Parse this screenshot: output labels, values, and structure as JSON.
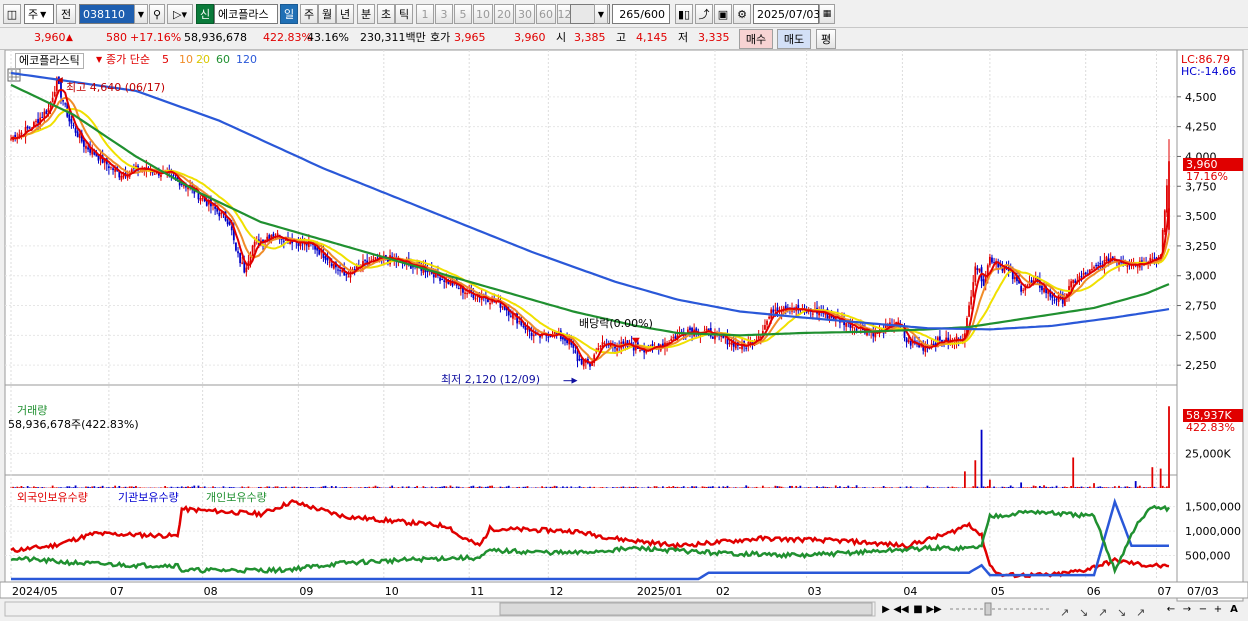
{
  "toolbar1": {
    "market_type": "주",
    "prev_label": "전",
    "stock_code": "038110",
    "credit_badge": "신",
    "stock_name": "에코플라스",
    "periods": [
      "일",
      "주",
      "월",
      "년",
      "분",
      "초",
      "틱"
    ],
    "active_period": "일",
    "intervals": [
      "1",
      "3",
      "5",
      "10",
      "20",
      "30",
      "60",
      "120"
    ],
    "count_display": "265/600",
    "date": "2025/07/03"
  },
  "quote": {
    "price": "3,960",
    "change": "580",
    "change_pct": "+17.16%",
    "volume": "58,936,678",
    "volume_ratio": "422.83%",
    "turnover": "43.16%",
    "amount": "230,311백만",
    "bid_label": "호가",
    "bid": "3,965",
    "ask": "3,960",
    "open_label": "시",
    "open": "3,385",
    "high_label": "고",
    "high": "4,145",
    "low_label": "저",
    "low": "3,335",
    "buy_label": "매수",
    "sell_label": "매도",
    "eval_label": "평"
  },
  "legend_price": {
    "name": "에코플라스틱",
    "ma_label": "종가 단순",
    "ma_periods": [
      "5",
      "10",
      "20",
      "60",
      "120"
    ]
  },
  "price_panel": {
    "lc": "LC:86.79",
    "hc": "HC:-14.66",
    "current_tag": "3,960",
    "current_pct": "17.16%",
    "high_note": "최고 4,640 (06/17)",
    "low_note": "최저 2,120 (12/09)",
    "dividend_note": "배당락(0.00%)"
  },
  "volume_panel": {
    "title": "거래량",
    "value_text": "58,936,678주(422.83%)",
    "tag": "58,937K",
    "tag_pct": "422.83%"
  },
  "holdings_panel": {
    "foreign_label": "외국인보유수량",
    "inst_label": "기관보유수량",
    "indiv_label": "개인보유수량"
  },
  "x_axis_labels": [
    "2024/05",
    "07",
    "08",
    "09",
    "10",
    "11",
    "12",
    "2025/01",
    "02",
    "03",
    "04",
    "05",
    "06",
    "07",
    "07/03"
  ],
  "colors": {
    "up": "#e00000",
    "down": "#0000c8",
    "ma5": "#e00000",
    "ma10": "#f08c28",
    "ma20": "#f0e000",
    "ma60": "#209030",
    "ma120": "#2a58d8",
    "bg": "#ffffff"
  },
  "chart_data": [
    {
      "type": "candlestick",
      "price_ticks": [
        2250,
        2500,
        2750,
        3000,
        3250,
        3500,
        3750,
        4000,
        4250,
        4500
      ],
      "ylim": [
        2000,
        4750
      ],
      "months": [
        "2024/05",
        "07",
        "08",
        "09",
        "10",
        "11",
        "12",
        "2025/01",
        "02",
        "03",
        "04",
        "05",
        "06",
        "07"
      ],
      "close_path": [
        [
          0,
          4150
        ],
        [
          10,
          4250
        ],
        [
          18,
          4400
        ],
        [
          22,
          4630
        ],
        [
          28,
          4300
        ],
        [
          35,
          4100
        ],
        [
          45,
          3950
        ],
        [
          52,
          3850
        ],
        [
          62,
          3900
        ],
        [
          75,
          3850
        ],
        [
          85,
          3750
        ],
        [
          95,
          3600
        ],
        [
          105,
          3450
        ],
        [
          108,
          3200
        ],
        [
          112,
          3050
        ],
        [
          116,
          3250
        ],
        [
          125,
          3350
        ],
        [
          135,
          3300
        ],
        [
          145,
          3250
        ],
        [
          152,
          3150
        ],
        [
          160,
          3000
        ],
        [
          170,
          3100
        ],
        [
          180,
          3150
        ],
        [
          190,
          3100
        ],
        [
          200,
          3050
        ],
        [
          210,
          2950
        ],
        [
          220,
          2850
        ],
        [
          228,
          2820
        ],
        [
          236,
          2750
        ],
        [
          245,
          2600
        ],
        [
          252,
          2480
        ],
        [
          260,
          2520
        ],
        [
          268,
          2450
        ],
        [
          272,
          2300
        ],
        [
          278,
          2250
        ],
        [
          282,
          2420
        ],
        [
          290,
          2420
        ],
        [
          300,
          2400
        ],
        [
          307,
          2380
        ],
        [
          315,
          2450
        ],
        [
          325,
          2550
        ],
        [
          335,
          2520
        ],
        [
          345,
          2450
        ],
        [
          352,
          2400
        ],
        [
          360,
          2520
        ],
        [
          366,
          2720
        ],
        [
          372,
          2750
        ],
        [
          380,
          2700
        ],
        [
          388,
          2700
        ],
        [
          395,
          2650
        ],
        [
          402,
          2600
        ],
        [
          410,
          2550
        ],
        [
          415,
          2520
        ],
        [
          420,
          2550
        ],
        [
          425,
          2620
        ],
        [
          430,
          2450
        ],
        [
          438,
          2400
        ],
        [
          445,
          2450
        ],
        [
          452,
          2450
        ],
        [
          458,
          2500
        ],
        [
          463,
          3100
        ],
        [
          467,
          2950
        ],
        [
          470,
          3150
        ],
        [
          478,
          3050
        ],
        [
          485,
          2900
        ],
        [
          492,
          2950
        ],
        [
          500,
          2820
        ],
        [
          505,
          2800
        ],
        [
          510,
          2950
        ],
        [
          520,
          3050
        ],
        [
          528,
          3150
        ],
        [
          534,
          3120
        ],
        [
          540,
          3100
        ],
        [
          548,
          3150
        ],
        [
          552,
          3150
        ],
        [
          556,
          3960
        ]
      ],
      "ma60_path": [
        [
          0,
          4600
        ],
        [
          30,
          4350
        ],
        [
          60,
          4000
        ],
        [
          90,
          3700
        ],
        [
          120,
          3450
        ],
        [
          150,
          3300
        ],
        [
          180,
          3150
        ],
        [
          210,
          3000
        ],
        [
          240,
          2850
        ],
        [
          270,
          2700
        ],
        [
          300,
          2580
        ],
        [
          320,
          2520
        ],
        [
          350,
          2500
        ],
        [
          380,
          2520
        ],
        [
          410,
          2530
        ],
        [
          440,
          2550
        ],
        [
          460,
          2570
        ],
        [
          490,
          2650
        ],
        [
          520,
          2730
        ],
        [
          545,
          2850
        ],
        [
          556,
          2930
        ]
      ],
      "ma120_path": [
        [
          0,
          4700
        ],
        [
          60,
          4550
        ],
        [
          100,
          4300
        ],
        [
          150,
          3900
        ],
        [
          200,
          3550
        ],
        [
          250,
          3200
        ],
        [
          290,
          2950
        ],
        [
          320,
          2800
        ],
        [
          350,
          2700
        ],
        [
          380,
          2650
        ],
        [
          420,
          2590
        ],
        [
          440,
          2560
        ],
        [
          470,
          2550
        ],
        [
          500,
          2580
        ],
        [
          530,
          2650
        ],
        [
          556,
          2720
        ]
      ],
      "highlights": {
        "high": {
          "date": "06/17",
          "value": 4640
        },
        "low": {
          "date": "12/09",
          "value": 2120
        },
        "last": 3960
      }
    },
    {
      "type": "bar",
      "title": "거래량",
      "unit": "K",
      "y_tick": 25000,
      "ylim": [
        0,
        62000
      ],
      "spikes": [
        [
          458,
          12000
        ],
        [
          463,
          20000
        ],
        [
          466,
          42000
        ],
        [
          470,
          6000
        ],
        [
          485,
          4000
        ],
        [
          510,
          22000
        ],
        [
          520,
          3500
        ],
        [
          540,
          5000
        ],
        [
          548,
          15000
        ],
        [
          552,
          14000
        ],
        [
          556,
          58937
        ]
      ]
    },
    {
      "type": "line",
      "title": "보유수량",
      "y_ticks": [
        500000,
        1000000,
        1500000
      ],
      "ylim": [
        0,
        1800000
      ],
      "series": [
        {
          "name": "외국인보유수량",
          "color": "#e00000",
          "values": [
            [
              0,
              600000
            ],
            [
              20,
              700000
            ],
            [
              40,
              950000
            ],
            [
              80,
              900000
            ],
            [
              82,
              1450000
            ],
            [
              120,
              1350000
            ],
            [
              135,
              1600000
            ],
            [
              160,
              1300000
            ],
            [
              185,
              1200000
            ],
            [
              210,
              1100000
            ],
            [
              215,
              900000
            ],
            [
              225,
              700000
            ],
            [
              230,
              1050000
            ],
            [
              270,
              1000000
            ],
            [
              290,
              850000
            ],
            [
              320,
              700000
            ],
            [
              360,
              850000
            ],
            [
              400,
              800000
            ],
            [
              430,
              700000
            ],
            [
              450,
              950000
            ],
            [
              460,
              1150000
            ],
            [
              466,
              900000
            ],
            [
              470,
              300000
            ],
            [
              475,
              100000
            ],
            [
              500,
              100000
            ],
            [
              515,
              200000
            ],
            [
              530,
              400000
            ],
            [
              545,
              300000
            ],
            [
              550,
              300000
            ],
            [
              556,
              250000
            ]
          ]
        },
        {
          "name": "기관보유수량",
          "color": "#2a58d8",
          "values": [
            [
              0,
              20000
            ],
            [
              200,
              20000
            ],
            [
              330,
              20000
            ],
            [
              335,
              150000
            ],
            [
              360,
              150000
            ],
            [
              460,
              150000
            ],
            [
              466,
              300000
            ],
            [
              470,
              100000
            ],
            [
              520,
              100000
            ],
            [
              530,
              1600000
            ],
            [
              538,
              700000
            ],
            [
              545,
              700000
            ],
            [
              556,
              700000
            ]
          ]
        },
        {
          "name": "개인보유수량",
          "color": "#209030",
          "values": [
            [
              0,
              450000
            ],
            [
              30,
              350000
            ],
            [
              60,
              300000
            ],
            [
              80,
              300000
            ],
            [
              82,
              200000
            ],
            [
              130,
              200000
            ],
            [
              160,
              350000
            ],
            [
              210,
              450000
            ],
            [
              225,
              450000
            ],
            [
              230,
              600000
            ],
            [
              270,
              550000
            ],
            [
              300,
              650000
            ],
            [
              340,
              550000
            ],
            [
              380,
              500000
            ],
            [
              440,
              650000
            ],
            [
              460,
              650000
            ],
            [
              466,
              700000
            ],
            [
              470,
              1300000
            ],
            [
              490,
              1400000
            ],
            [
              520,
              1300000
            ],
            [
              530,
              200000
            ],
            [
              540,
              1100000
            ],
            [
              548,
              1500000
            ],
            [
              556,
              1450000
            ]
          ]
        }
      ]
    }
  ]
}
